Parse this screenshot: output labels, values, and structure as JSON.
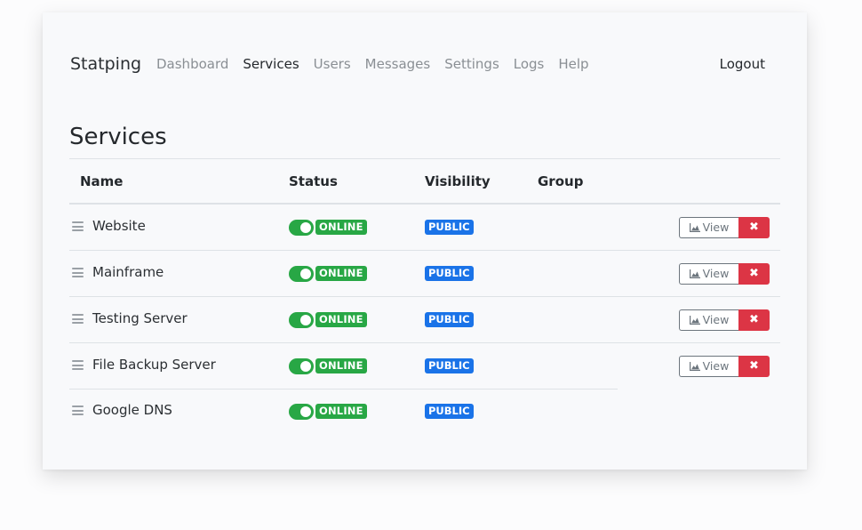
{
  "navbar": {
    "brand": "Statping",
    "links": [
      "Dashboard",
      "Services",
      "Users",
      "Messages",
      "Settings",
      "Logs",
      "Help"
    ],
    "active": "Services",
    "logout": "Logout"
  },
  "page": {
    "title": "Services"
  },
  "table": {
    "columns": {
      "name": "Name",
      "status": "Status",
      "visibility": "Visibility",
      "group": "Group"
    },
    "rows": [
      {
        "name": "Website",
        "status": "ONLINE",
        "visibility": "PUBLIC",
        "group": "",
        "view_label": "View",
        "delete_label": "✖"
      },
      {
        "name": "Mainframe",
        "status": "ONLINE",
        "visibility": "PUBLIC",
        "group": "",
        "view_label": "View",
        "delete_label": "✖"
      },
      {
        "name": "Testing Server",
        "status": "ONLINE",
        "visibility": "PUBLIC",
        "group": "",
        "view_label": "View",
        "delete_label": "✖"
      },
      {
        "name": "File Backup Server",
        "status": "ONLINE",
        "visibility": "PUBLIC",
        "group": "",
        "view_label": "View",
        "delete_label": "✖"
      },
      {
        "name": "Google DNS",
        "status": "ONLINE",
        "visibility": "PUBLIC",
        "group": ""
      }
    ]
  },
  "icons": {
    "drag": "bars-icon",
    "view": "chart-area-icon",
    "delete": "times-icon"
  },
  "colors": {
    "online": "#28a745",
    "public": "#1a73e8",
    "danger": "#dc3545"
  }
}
